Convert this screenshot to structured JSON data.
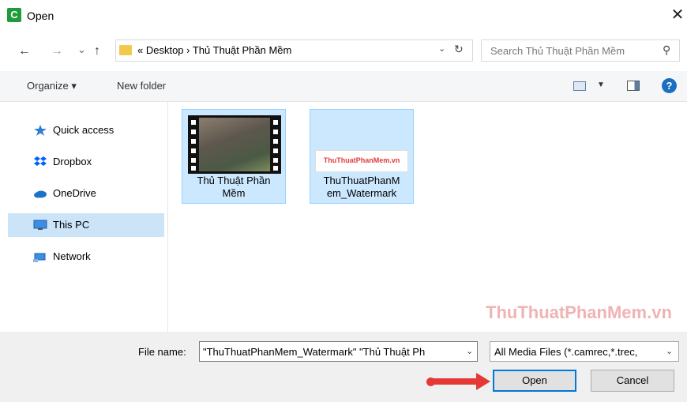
{
  "window": {
    "title": "Open",
    "close_glyph": "✕"
  },
  "nav": {
    "back_glyph": "←",
    "forward_glyph": "→",
    "recent_glyph": "⌄",
    "up_glyph": "↑",
    "breadcrumb": "«  Desktop  ›  Thủ Thuật Phần Mềm",
    "address_dropdown_glyph": "⌄",
    "refresh_glyph": "↻"
  },
  "search": {
    "placeholder": "Search Thủ Thuật Phần Mềm",
    "icon": "search-icon",
    "glyph": "⚲"
  },
  "toolbar": {
    "organize_label": "Organize ▾",
    "new_folder_label": "New folder",
    "view_dd_glyph": "▼",
    "help_glyph": "?"
  },
  "sidebar": {
    "items": [
      {
        "label": "Quick access",
        "icon": "star-icon",
        "selected": false
      },
      {
        "label": "Dropbox",
        "icon": "dropbox-icon",
        "selected": false
      },
      {
        "label": "OneDrive",
        "icon": "cloud-icon",
        "selected": false
      },
      {
        "label": "This PC",
        "icon": "computer-icon",
        "selected": true
      },
      {
        "label": "Network",
        "icon": "network-icon",
        "selected": false
      }
    ]
  },
  "files": [
    {
      "line1": "Thủ Thuật Phần",
      "line2": "Mềm",
      "type": "video",
      "selected": true
    },
    {
      "line1": "ThuThuatPhanM",
      "line2": "em_Watermark",
      "type": "image",
      "selected": true,
      "thumb_text": "ThuThuatPhanMem.vn"
    }
  ],
  "watermark": "ThuThuatPhanMem.vn",
  "bottom": {
    "filename_label": "File name:",
    "filename_value": "\"ThuThuatPhanMem_Watermark\" \"Thủ Thuật Ph",
    "filename_dd_glyph": "⌄",
    "filetype_value": "All Media Files (*.camrec,*.trec,",
    "filetype_dd_glyph": "⌄",
    "open_label": "Open",
    "cancel_label": "Cancel"
  },
  "colors": {
    "accent": "#0078d7",
    "selection": "#cce8ff",
    "arrow": "#e53935",
    "app_icon": "#1e9c3a"
  }
}
